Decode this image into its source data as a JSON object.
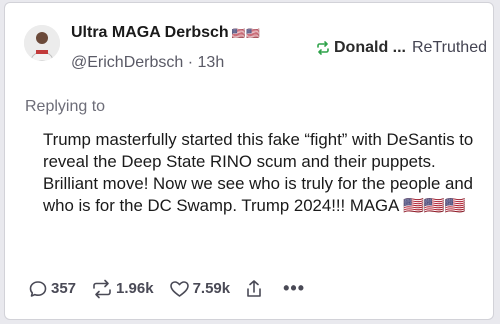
{
  "post": {
    "author_name": "Ultra MAGA Derbsch",
    "author_flags": "🇺🇸🇺🇸",
    "handle": "@ErichDerbsch",
    "separator": "·",
    "time": "13h",
    "retruth_by": "Donald ...",
    "retruth_label": "ReTruthed",
    "replying_to": "Replying to",
    "text": "Trump masterfully started this fake “fight” with DeSantis to reveal the Deep State RINO scum and their puppets. Brilliant move! Now we see who is truly for the people and who is for the DC Swamp. Trump 2024!!! MAGA 🇺🇸🇺🇸🇺🇸"
  },
  "actions": {
    "replies": "357",
    "retruths": "1.96k",
    "likes": "7.59k",
    "more": "•••"
  },
  "colors": {
    "background": "#e9e9ee",
    "card": "#ffffff",
    "retruth_icon": "#2fa34a",
    "secondary_text": "#5a5a66"
  },
  "icons": [
    "reply-icon",
    "retruth-icon",
    "like-icon",
    "share-icon",
    "more-icon"
  ]
}
